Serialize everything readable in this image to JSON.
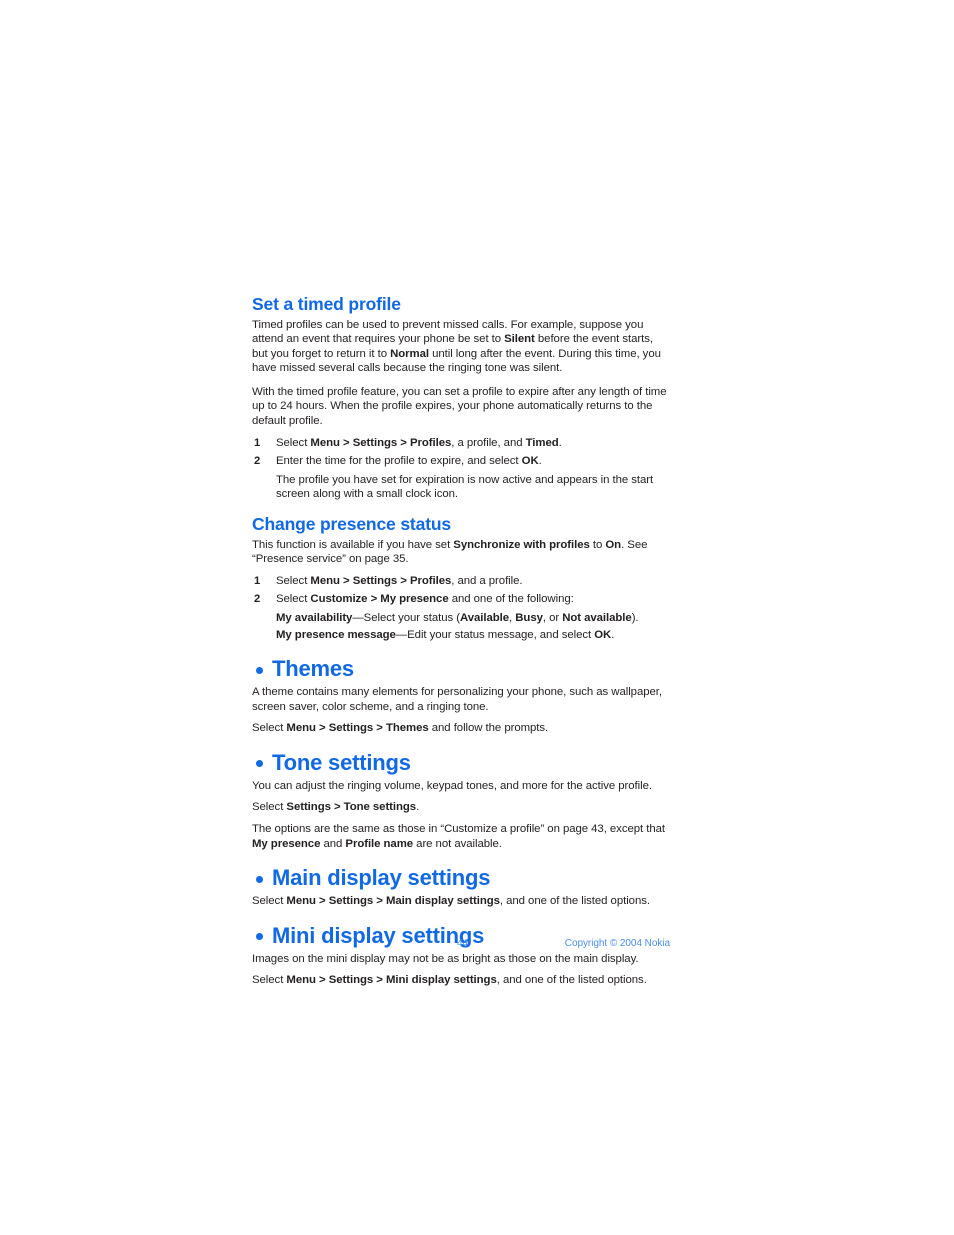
{
  "document": {
    "page_number": "44",
    "copyright": "Copyright © 2004 Nokia",
    "accent_color": "#1169e3",
    "footer_color": "#4b8fe6",
    "body_color": "#231f20",
    "background_color": "#ffffff"
  },
  "sections": {
    "set_timed_profile": {
      "heading": "Set a timed profile",
      "para1_a": "Timed profiles can be used to prevent missed calls. For example, suppose you attend an event that requires your phone be set to ",
      "para1_b": "Silent",
      "para1_c": " before the event starts, but you forget to return it to ",
      "para1_d": "Normal",
      "para1_e": " until long after the event. During this time, you have missed several calls because the ringing tone was silent.",
      "para2": "With the timed profile feature, you can set a profile to expire after any length of time up to 24 hours. When the profile expires, your phone automatically returns to the default profile.",
      "step1_num": "1",
      "step1_a": "Select ",
      "step1_b": "Menu > Settings > Profiles",
      "step1_c": ", a profile, and ",
      "step1_d": "Timed",
      "step1_e": ".",
      "step2_num": "2",
      "step2_a": "Enter the time for the profile to expire, and select ",
      "step2_b": "OK",
      "step2_c": ".",
      "step2_note": "The profile you have set for expiration is now active and appears in the start screen along with a small clock icon."
    },
    "change_presence_status": {
      "heading": "Change presence status",
      "para1_a": "This function is available if you have set ",
      "para1_b": "Synchronize with profiles",
      "para1_c": " to ",
      "para1_d": "On",
      "para1_e": ". See “Presence service” on page 35.",
      "step1_num": "1",
      "step1_a": "Select ",
      "step1_b": "Menu > Settings > Profiles",
      "step1_c": ", and a profile.",
      "step2_num": "2",
      "step2_a": "Select ",
      "step2_b": "Customize > My presence",
      "step2_c": " and one of the following:",
      "sub1_label": "My availability",
      "sub1_a": "—Select your status (",
      "sub1_b": "Available",
      "sub1_c": ", ",
      "sub1_d": "Busy",
      "sub1_e": ", or ",
      "sub1_f": "Not available",
      "sub1_g": ").",
      "sub2_label": "My presence message",
      "sub2_a": "—Edit your status message, and select ",
      "sub2_b": "OK",
      "sub2_c": "."
    },
    "themes": {
      "heading": "Themes",
      "para1": "A theme contains many elements for personalizing your phone, such as wallpaper, screen saver, color scheme, and a ringing tone.",
      "para2_a": "Select ",
      "para2_b": "Menu > Settings > Themes",
      "para2_c": " and follow the prompts."
    },
    "tone_settings": {
      "heading": "Tone settings",
      "para1": "You can adjust the ringing volume, keypad tones, and more for the active profile.",
      "para2_a": "Select ",
      "para2_b": "Settings > Tone settings",
      "para2_c": ".",
      "para3_a": "The options are the same as those in “Customize a profile” on page 43, except that ",
      "para3_b": "My presence",
      "para3_c": " and ",
      "para3_d": "Profile name",
      "para3_e": " are not available."
    },
    "main_display_settings": {
      "heading": "Main display settings",
      "para1_a": "Select ",
      "para1_b": "Menu > Settings > Main display settings",
      "para1_c": ", and one of the listed options."
    },
    "mini_display_settings": {
      "heading": "Mini display settings",
      "para1": "Images on the mini display may not be as bright as those on the main display.",
      "para2_a": "Select ",
      "para2_b": "Menu > Settings > Mini display settings",
      "para2_c": ", and one of the listed options."
    }
  }
}
